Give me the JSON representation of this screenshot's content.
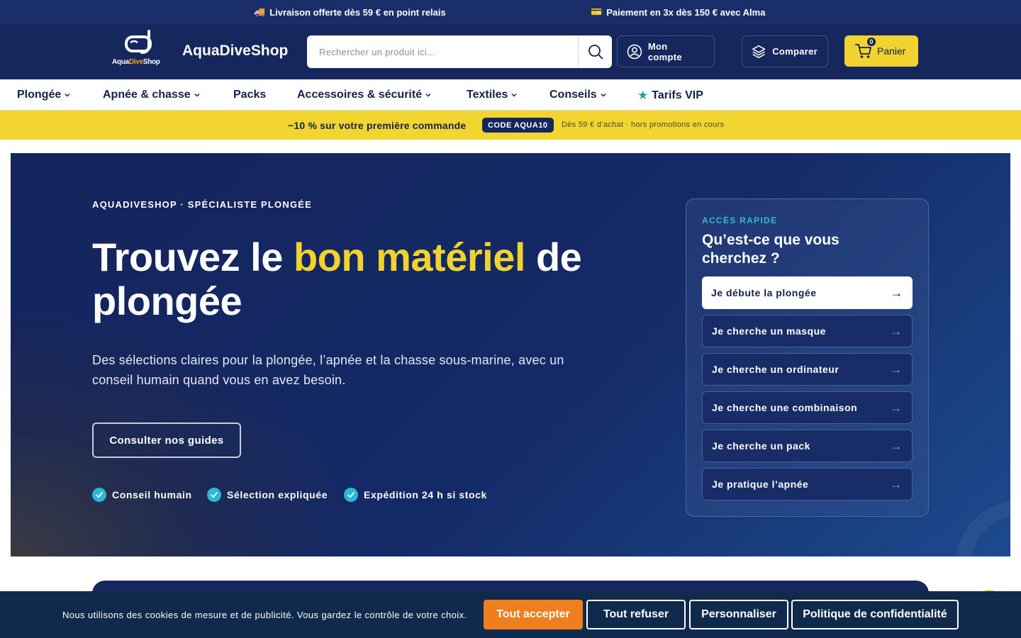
{
  "topbar": {
    "shipping": "Livraison offerte dès 59 € en point relais",
    "payment": "Paiement en 3x dès 150 € avec Alma"
  },
  "header": {
    "logo_word1": "Aqua",
    "logo_word2": "Dive",
    "logo_word3": "Shop",
    "brand": "AquaDiveShop",
    "search_placeholder": "Rechercher un produit ici...",
    "account_label": "Mon compte",
    "compare_label": "Comparer",
    "cart_label": "Panier",
    "cart_count": "0"
  },
  "nav": {
    "items": [
      {
        "label": "Plongée",
        "dropdown": true
      },
      {
        "label": "Apnée & chasse",
        "dropdown": true
      },
      {
        "label": "Packs",
        "dropdown": false
      },
      {
        "label": "Accessoires & sécurité",
        "dropdown": true
      },
      {
        "label": "Textiles",
        "dropdown": true
      },
      {
        "label": "Conseils",
        "dropdown": true
      },
      {
        "label": "Tarifs VIP",
        "dropdown": false,
        "icon": "star-icon"
      }
    ]
  },
  "promo": {
    "headline": "−10 % sur votre première commande",
    "code": "CODE AQUA10",
    "conditions": "Dès 59 € d’achat · hors promotions en cours"
  },
  "hero": {
    "eyebrow": "AQUADIVESHOP · SPÉCIALISTE PLONGÉE",
    "title_before": "Trouvez le ",
    "title_highlight": "bon matériel",
    "title_after": " de plongée",
    "lead": "Des sélections claires pour la plongée, l’apnée et la chasse sous-marine, avec un conseil humain quand vous en avez besoin.",
    "guides_button": "Consulter nos guides",
    "features": [
      "Conseil humain",
      "Sélection expliquée",
      "Expédition 24 h si stock"
    ]
  },
  "quick_access": {
    "label": "ACCÈS RAPIDE",
    "title": "Qu’est-ce que vous cherchez ?",
    "options": [
      "Je débute la plongée",
      "Je cherche un masque",
      "Je cherche un ordinateur",
      "Je cherche une combinaison",
      "Je cherche un pack",
      "Je pratique l’apnée"
    ],
    "arrow": "→"
  },
  "cookie": {
    "text": "Nous utilisons des cookies de mesure et de publicité. Vous gardez le contrôle de votre choix.",
    "accept": "Tout accepter",
    "refuse": "Tout refuser",
    "customize": "Personnaliser",
    "privacy": "Politique de confidentialité"
  },
  "colors": {
    "navy": "#16275e",
    "yellow": "#f2d22e",
    "cyan": "#2bb7d6",
    "orange": "#f07d1e",
    "cookie_bg": "#0f2a4d"
  }
}
